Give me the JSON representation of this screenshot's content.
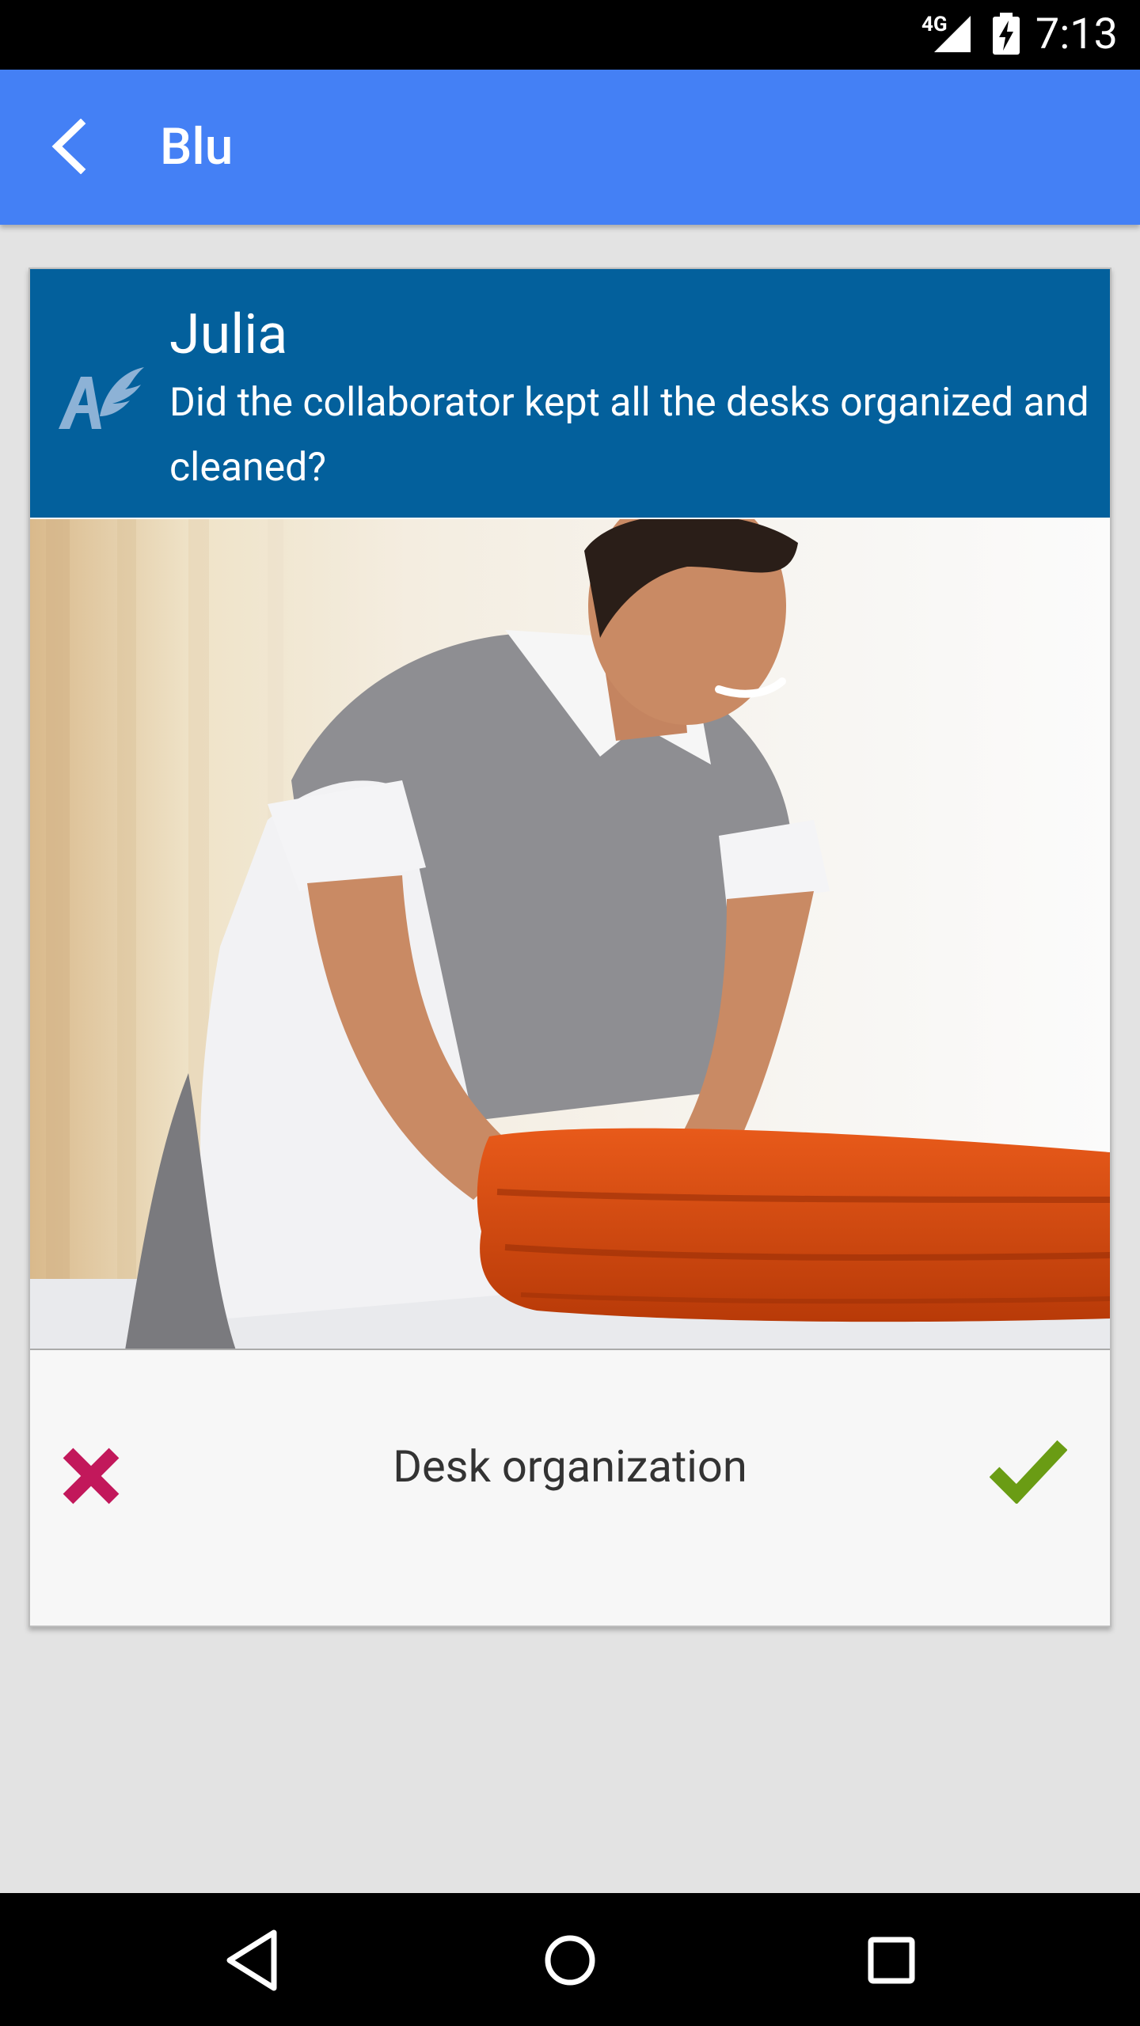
{
  "status_bar": {
    "network": "4G",
    "time": "7:13"
  },
  "app_bar": {
    "title": "Blu",
    "back_icon": "arrow-back-icon"
  },
  "card": {
    "header": {
      "logo_icon": "winged-a-logo",
      "name": "Julia",
      "question": "Did the collaborator kept all the desks organized and cleaned?"
    },
    "photo_icon": "housekeeper-folding-towels-photo",
    "footer": {
      "label": "Desk organization",
      "reject_icon": "cross-icon",
      "approve_icon": "check-icon",
      "reject_color": "#c2185b",
      "approve_color": "#6a9c14"
    }
  },
  "colors": {
    "app_bar": "#4480f5",
    "card_header": "#03609c",
    "background": "#e3e3e3"
  },
  "nav_bar": {
    "buttons": [
      "back-triangle-icon",
      "home-circle-icon",
      "recents-square-icon"
    ]
  }
}
